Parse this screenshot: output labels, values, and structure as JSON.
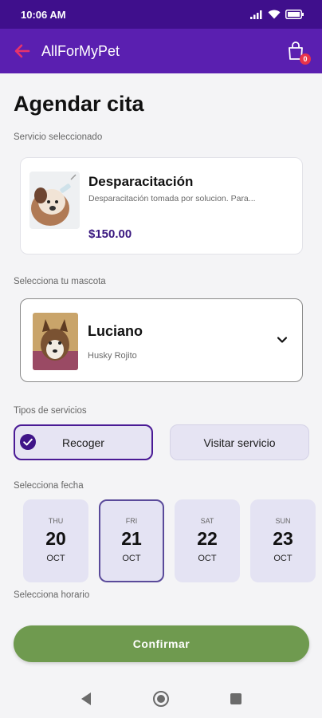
{
  "status_bar": {
    "time": "10:06 AM"
  },
  "app_bar": {
    "title": "AllForMyPet",
    "cart_count": "0"
  },
  "page": {
    "title": "Agendar cita"
  },
  "service": {
    "section_label": "Servicio seleccionado",
    "name": "Desparacitación",
    "description": "Desparacitación tomada por solucion. Para...",
    "price": "$150.00"
  },
  "pet": {
    "section_label": "Selecciona tu mascota",
    "name": "Luciano",
    "breed": "Husky Rojito"
  },
  "service_types": {
    "section_label": "Tipos de servicios",
    "options": [
      {
        "label": "Recoger",
        "selected": true
      },
      {
        "label": "Visitar servicio",
        "selected": false
      }
    ]
  },
  "dates": {
    "section_label": "Selecciona fecha",
    "items": [
      {
        "dow": "THU",
        "day": "20",
        "month": "OCT",
        "selected": false
      },
      {
        "dow": "FRI",
        "day": "21",
        "month": "OCT",
        "selected": true
      },
      {
        "dow": "SAT",
        "day": "22",
        "month": "OCT",
        "selected": false
      },
      {
        "dow": "SUN",
        "day": "23",
        "month": "OCT",
        "selected": false
      }
    ]
  },
  "schedule": {
    "section_label": "Selecciona horario"
  },
  "confirm": {
    "label": "Confirmar"
  },
  "icons": {
    "back": "arrow-left-icon",
    "cart": "shopping-bag-icon",
    "chevron": "chevron-down-icon",
    "check": "check-circle-icon",
    "nav_back": "triangle-back-icon",
    "nav_home": "circle-home-icon",
    "nav_recents": "square-recents-icon"
  },
  "colors": {
    "status_bar": "#3f0f8c",
    "app_bar": "#5a1fb0",
    "accent": "#4a1a95",
    "price": "#3a1880",
    "back_arrow": "#e8336b",
    "badge": "#e8334a",
    "confirm": "#6f9a4f",
    "chip_bg": "#e6e4f3"
  }
}
